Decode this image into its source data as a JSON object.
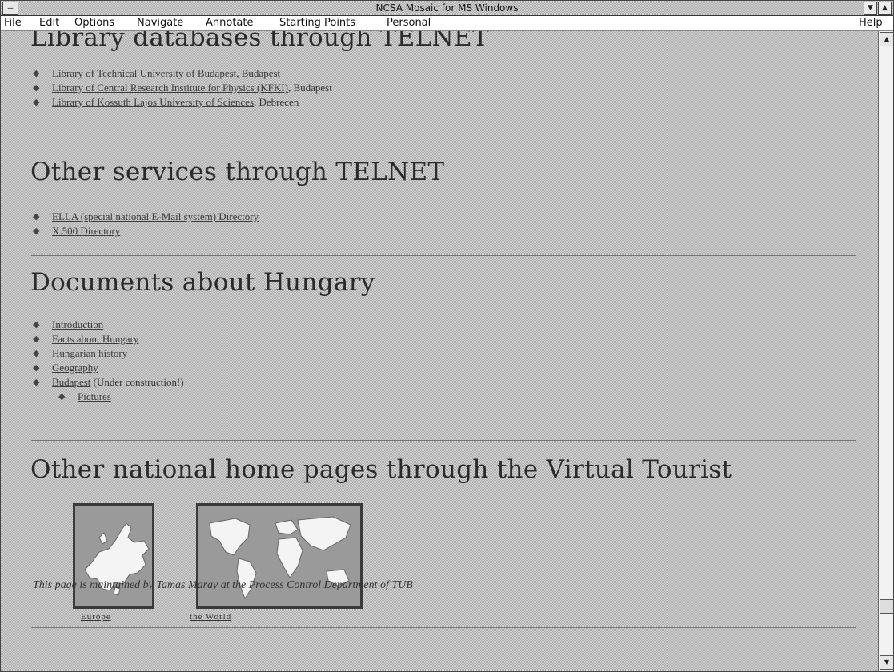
{
  "window": {
    "title": "NCSA Mosaic for MS Windows",
    "system_menu_glyph": "—",
    "minimize_glyph": "▼",
    "maximize_glyph": "▲"
  },
  "menu": {
    "file": "File",
    "edit": "Edit",
    "options": "Options",
    "navigate": "Navigate",
    "annotate": "Annotate",
    "starting_points": "Starting Points",
    "personal": "Personal",
    "help": "Help"
  },
  "sections": {
    "library": {
      "heading": "Library databases through TELNET",
      "items": [
        {
          "link": "Library of Technical University of Budapest",
          "suffix": ", Budapest"
        },
        {
          "link": "Library of Central Research Institute for Physics (KFKI)",
          "suffix": ", Budapest"
        },
        {
          "link": "Library of Kossuth Lajos University of Sciences",
          "suffix": ", Debrecen"
        }
      ]
    },
    "services": {
      "heading": "Other services through TELNET",
      "items": [
        {
          "link": "ELLA (special national E-Mail system) Directory",
          "suffix": ""
        },
        {
          "link": "X.500 Directory",
          "suffix": ""
        }
      ]
    },
    "documents": {
      "heading": "Documents about Hungary",
      "items": [
        {
          "link": "Introduction",
          "suffix": ""
        },
        {
          "link": "Facts about Hungary",
          "suffix": ""
        },
        {
          "link": "Hungarian history",
          "suffix": ""
        },
        {
          "link": "Geography",
          "suffix": ""
        },
        {
          "link": "Budapest",
          "suffix": " (Under construction!)"
        },
        {
          "link": "Pictures",
          "suffix": ""
        }
      ]
    },
    "national": {
      "heading": "Other national home pages through the Virtual Tourist",
      "maps": [
        {
          "label": "Europe"
        },
        {
          "label": "the World"
        }
      ]
    }
  },
  "footer": {
    "text": "This page is maintained by Tamas Maray at the Process Control Department of TUB"
  },
  "scrollbar": {
    "up_glyph": "▲",
    "down_glyph": "▼"
  }
}
